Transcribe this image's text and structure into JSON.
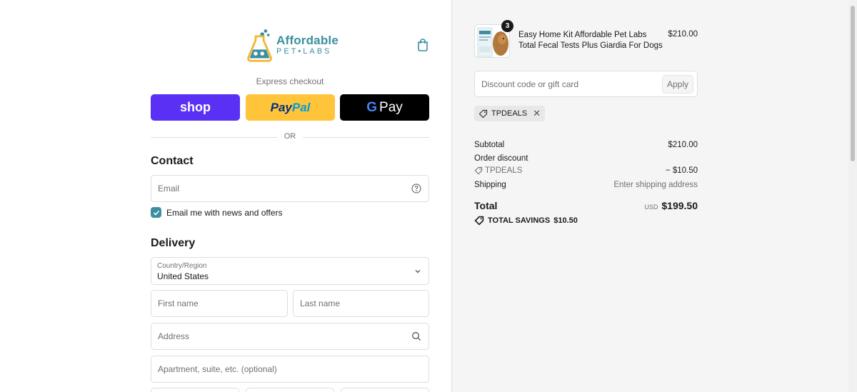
{
  "brand": {
    "name_main": "Affordable",
    "name_sub": "PET•LABS",
    "accent_color": "#3b8fa0",
    "cart_icon": "shopping-bag-icon"
  },
  "express": {
    "label": "Express checkout",
    "shop_label": "shop",
    "paypal_label_1": "Pay",
    "paypal_label_2": "Pal",
    "gpay_g": "G",
    "gpay_label": "Pay",
    "separator": "OR"
  },
  "contact": {
    "title": "Contact",
    "email_placeholder": "Email",
    "help_icon": "question-circle-icon",
    "newsletter_label": "Email me with news and offers",
    "newsletter_checked": true
  },
  "delivery": {
    "title": "Delivery",
    "country_label": "Country/Region",
    "country_value": "United States",
    "first_name_placeholder": "First name",
    "last_name_placeholder": "Last name",
    "address_placeholder": "Address",
    "apartment_placeholder": "Apartment, suite, etc. (optional)"
  },
  "order": {
    "item": {
      "name": "Easy Home Kit Affordable Pet Labs Total Fecal Tests Plus Giardia For Dogs",
      "price": "$210.00",
      "quantity": "3"
    },
    "discount_placeholder": "Discount code or gift card",
    "apply_label": "Apply",
    "applied_code": "TPDEALS",
    "subtotal_label": "Subtotal",
    "subtotal_value": "$210.00",
    "order_discount_label": "Order discount",
    "discount_code": "TPDEALS",
    "discount_value": "− $10.50",
    "shipping_label": "Shipping",
    "shipping_value": "Enter shipping address",
    "total_label": "Total",
    "currency": "USD",
    "total_value": "$199.50",
    "savings_label": "TOTAL SAVINGS",
    "savings_value": "$10.50"
  }
}
